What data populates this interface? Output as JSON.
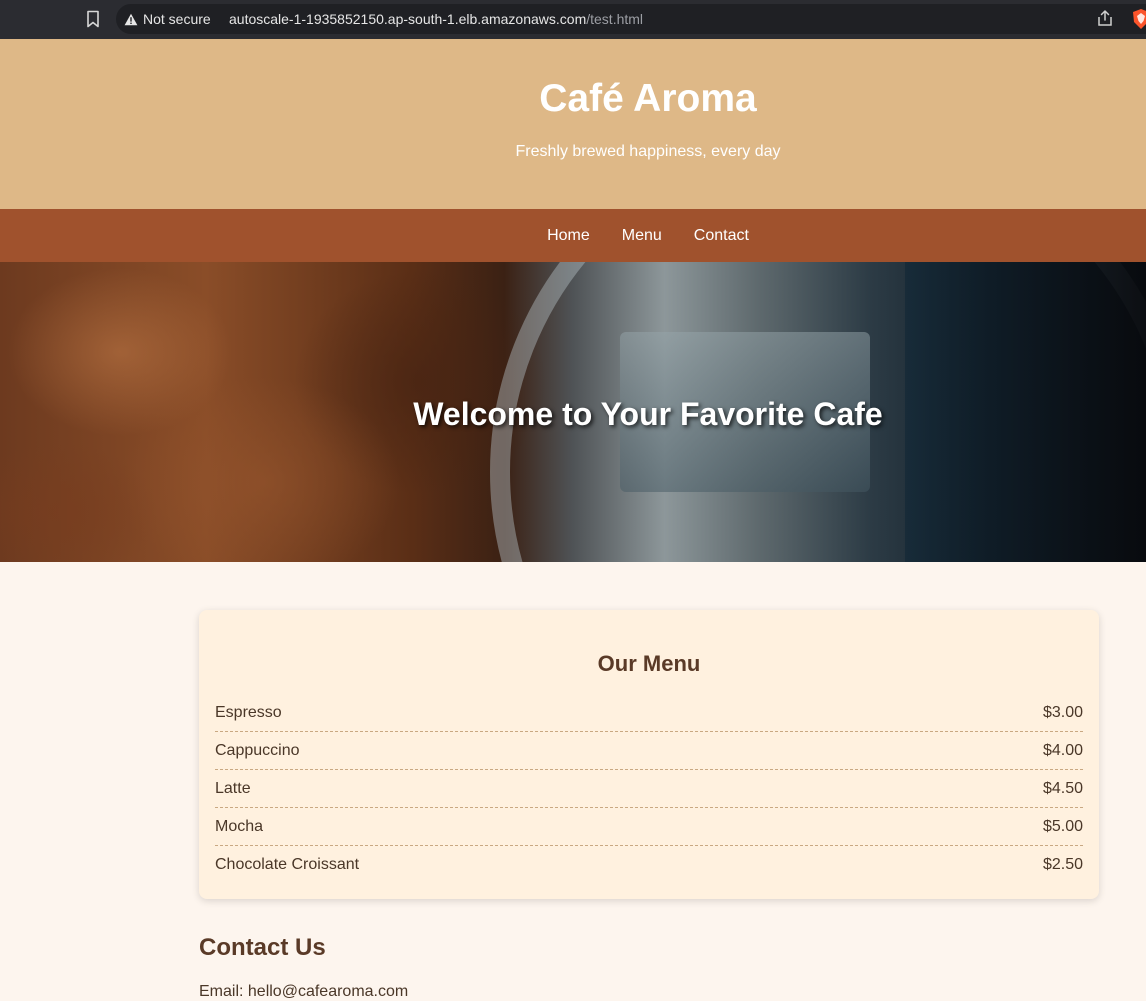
{
  "browser": {
    "security_label": "Not secure",
    "url_host": "autoscale-1-1935852150.ap-south-1.elb.amazonaws.com",
    "url_path": "/test.html"
  },
  "header": {
    "title": "Café Aroma",
    "tagline": "Freshly brewed happiness, every day"
  },
  "nav": {
    "items": [
      {
        "label": "Home"
      },
      {
        "label": "Menu"
      },
      {
        "label": "Contact"
      }
    ]
  },
  "hero": {
    "heading": "Welcome to Your Favorite Cafe"
  },
  "menu": {
    "title": "Our Menu",
    "items": [
      {
        "name": "Espresso",
        "price": "$3.00"
      },
      {
        "name": "Cappuccino",
        "price": "$4.00"
      },
      {
        "name": "Latte",
        "price": "$4.50"
      },
      {
        "name": "Mocha",
        "price": "$5.00"
      },
      {
        "name": "Chocolate Croissant",
        "price": "$2.50"
      }
    ]
  },
  "contact": {
    "heading": "Contact Us",
    "email_line": "Email: hello@cafearoma.com"
  },
  "colors": {
    "header_bg": "#deb887",
    "nav_bg": "#a0522d",
    "page_bg": "#fdf5ee",
    "card_bg": "#fff1df",
    "heading_text": "#5a3a27",
    "annotation": "#e0262e"
  }
}
